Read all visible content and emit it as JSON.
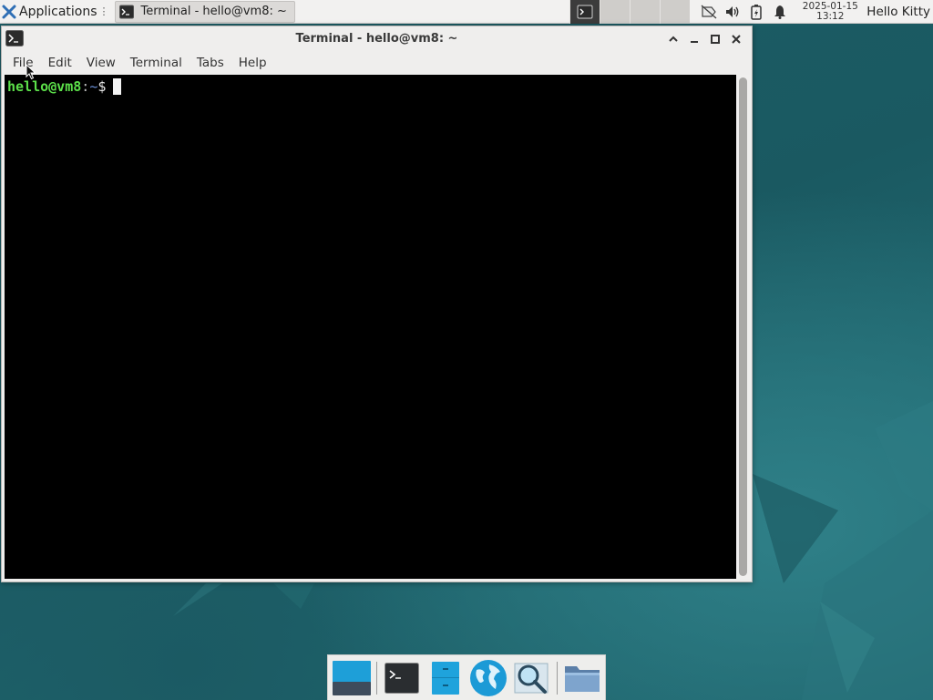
{
  "top_panel": {
    "applications_label": "Applications",
    "applications_icon": "xfce-logo-icon",
    "task_button": {
      "label": "Terminal - hello@vm8: ~",
      "icon": "terminal-icon"
    },
    "workspaces": [
      {
        "name": "workspace-1",
        "active": true
      },
      {
        "name": "workspace-2",
        "active": false
      },
      {
        "name": "workspace-3",
        "active": false
      },
      {
        "name": "workspace-4",
        "active": false
      }
    ],
    "tray_icons": [
      "network-icon",
      "volume-icon",
      "battery-icon",
      "bell-icon"
    ],
    "clock": {
      "date": "2025-01-15",
      "time": "13:12"
    },
    "user": "Hello Kitty"
  },
  "window": {
    "title": "Terminal - hello@vm8: ~",
    "controls": [
      "shade-up",
      "minimize",
      "maximize",
      "close"
    ],
    "menu": [
      "File",
      "Edit",
      "View",
      "Terminal",
      "Tabs",
      "Help"
    ],
    "terminal": {
      "prompt_user_host": "hello@vm8",
      "prompt_separator": ":",
      "prompt_path": "~",
      "prompt_symbol": "$"
    }
  },
  "dock": {
    "items": [
      {
        "name": "show-desktop",
        "icon": "show-desktop-icon"
      },
      {
        "name": "terminal",
        "icon": "terminal-emulator-icon"
      },
      {
        "name": "file-manager",
        "icon": "file-manager-icon"
      },
      {
        "name": "web-browser",
        "icon": "web-browser-icon"
      },
      {
        "name": "app-finder",
        "icon": "app-finder-icon"
      },
      {
        "name": "folder",
        "icon": "folder-icon"
      }
    ]
  },
  "colors": {
    "desktop": "#1f5f68",
    "panel": "#f2f1f0",
    "terminal_bg": "#000000",
    "prompt_user": "#5ce04a",
    "prompt_path": "#6b8fd6"
  }
}
